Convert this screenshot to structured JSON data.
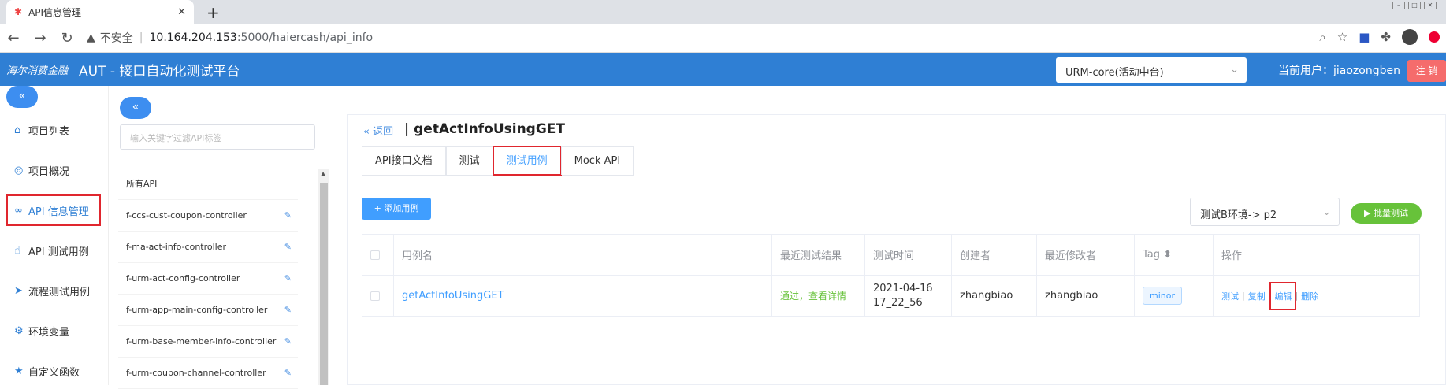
{
  "browser": {
    "tab_title": "API信息管理",
    "new_tab": "+",
    "not_secure": "不安全",
    "url_host": "10.164.204.153",
    "url_rest": ":5000/haiercash/api_info"
  },
  "appbar": {
    "logo": "海尔消费金融",
    "title": "AUT - 接口自动化测试平台",
    "project_select": "URM-core(活动中台)",
    "current_user": "当前用户：jiaozongben",
    "logout": "注 销"
  },
  "sidebar": {
    "collapse": "«",
    "items": [
      {
        "label": "项目列表",
        "icon": "home-icon"
      },
      {
        "label": "项目概况",
        "icon": "eye-icon"
      },
      {
        "label": "API 信息管理",
        "icon": "link-icon"
      },
      {
        "label": "API 测试用例",
        "icon": "hand-icon"
      },
      {
        "label": "流程测试用例",
        "icon": "send-icon"
      },
      {
        "label": "环境变量",
        "icon": "gear-icon"
      },
      {
        "label": "自定义函数",
        "icon": "star-icon"
      }
    ]
  },
  "controller_panel": {
    "collapse": "«",
    "filter_placeholder": "输入关键字过滤API标签",
    "items": [
      "所有API",
      "f-ccs-cust-coupon-controller",
      "f-ma-act-info-controller",
      "f-urm-act-config-controller",
      "f-urm-app-main-config-controller",
      "f-urm-base-member-info-controller",
      "f-urm-coupon-channel-controller"
    ]
  },
  "main": {
    "back": "« 返回",
    "api_name": "| getActInfoUsingGET",
    "tabs": [
      "API接口文档",
      "测试",
      "测试用例",
      "Mock API"
    ],
    "add_case": "+ 添加用例",
    "env_select": "测试B环境-> p2",
    "batch_test": "▶ 批量测试",
    "table": {
      "headers": [
        "用例名",
        "最近测试结果",
        "测试时间",
        "创建者",
        "最近修改者",
        "Tag ⬍",
        "操作"
      ],
      "rows": [
        {
          "name": "getActInfoUsingGET",
          "result": "通过，查看详情",
          "time": "2021-04-16 17_22_56",
          "creator": "zhangbiao",
          "modifier": "zhangbiao",
          "tag": "minor",
          "ops": [
            "测试",
            "复制",
            "编辑",
            "删除"
          ]
        }
      ]
    }
  }
}
